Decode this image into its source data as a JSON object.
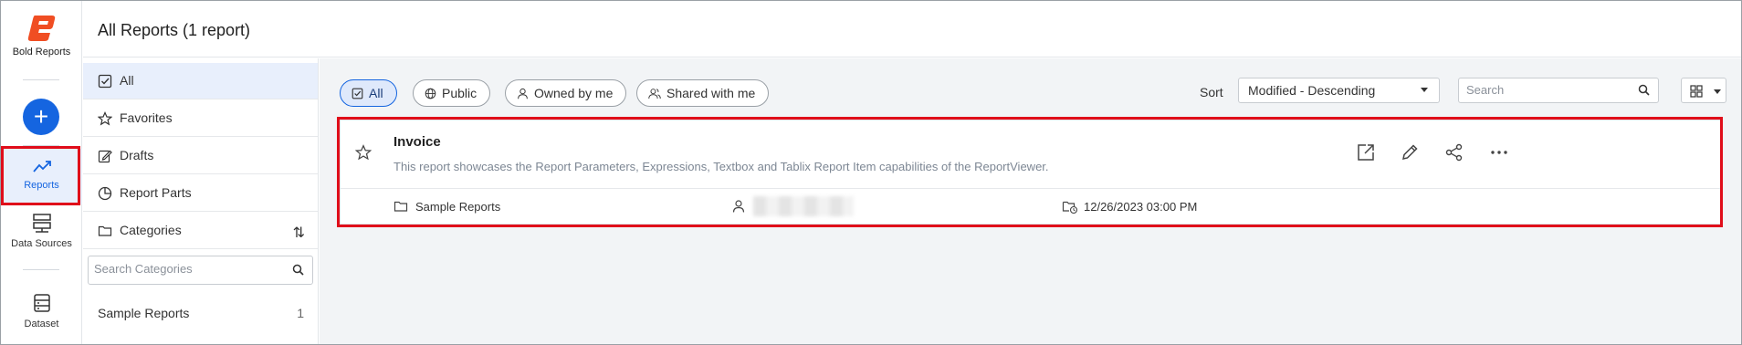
{
  "app": {
    "brand_name": "Bold Reports",
    "page_title": "All Reports (1 report)"
  },
  "rail": {
    "create_label": "+",
    "items": [
      {
        "label": "Reports",
        "icon": "trending-up-icon",
        "active": true
      },
      {
        "label": "Data Sources",
        "icon": "data-sources-icon",
        "active": false
      },
      {
        "label": "Dataset",
        "icon": "dataset-icon",
        "active": false
      }
    ]
  },
  "categories_pane": {
    "items": [
      {
        "label": "All",
        "icon": "checkbox-icon",
        "active": true
      },
      {
        "label": "Favorites",
        "icon": "star-icon",
        "active": false
      },
      {
        "label": "Drafts",
        "icon": "edit-icon",
        "active": false
      },
      {
        "label": "Report Parts",
        "icon": "pie-icon",
        "active": false
      },
      {
        "label": "Categories",
        "icon": "folder-icon",
        "active": false
      }
    ],
    "search_placeholder": "Search Categories",
    "category_list": [
      {
        "name": "Sample Reports",
        "count": "1"
      }
    ]
  },
  "filters": {
    "chips": [
      {
        "label": "All",
        "icon": "checkbox-icon",
        "active": true
      },
      {
        "label": "Public",
        "icon": "globe-icon",
        "active": false
      },
      {
        "label": "Owned by me",
        "icon": "user-icon",
        "active": false
      },
      {
        "label": "Shared with me",
        "icon": "users-icon",
        "active": false
      }
    ],
    "sort_label": "Sort",
    "sort_value": "Modified - Descending",
    "search_placeholder": "Search"
  },
  "reports": [
    {
      "name": "Invoice",
      "description": "This report showcases the Report Parameters, Expressions, Textbox and Tablix Report Item capabilities of the ReportViewer.",
      "category": "Sample Reports",
      "modified": "12/26/2023 03:00 PM"
    }
  ],
  "colors": {
    "accent": "#1565e0",
    "highlight_box": "#e00d1a",
    "brand": "#f04e23"
  }
}
